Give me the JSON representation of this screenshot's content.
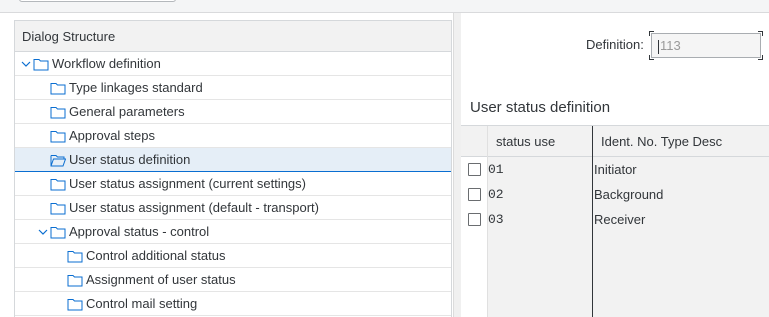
{
  "tree": {
    "header": "Dialog Structure",
    "items": [
      {
        "label": "Workflow definition",
        "level": 0,
        "expanded": true,
        "folder": "closed"
      },
      {
        "label": "Type linkages standard",
        "level": 1,
        "expanded": null,
        "folder": "closed"
      },
      {
        "label": "General parameters",
        "level": 1,
        "expanded": null,
        "folder": "closed"
      },
      {
        "label": "Approval steps",
        "level": 1,
        "expanded": null,
        "folder": "closed"
      },
      {
        "label": "User status definition",
        "level": 1,
        "expanded": null,
        "folder": "open",
        "selected": true
      },
      {
        "label": "User status assignment (current settings)",
        "level": 1,
        "expanded": null,
        "folder": "closed"
      },
      {
        "label": "User status assignment (default - transport)",
        "level": 1,
        "expanded": null,
        "folder": "closed"
      },
      {
        "label": "Approval status - control",
        "level": 1,
        "expanded": true,
        "folder": "closed"
      },
      {
        "label": "Control additional status",
        "level": 2,
        "expanded": null,
        "folder": "closed"
      },
      {
        "label": "Assignment of user status",
        "level": 2,
        "expanded": null,
        "folder": "closed"
      },
      {
        "label": "Control mail setting",
        "level": 2,
        "expanded": null,
        "folder": "closed"
      }
    ]
  },
  "definition": {
    "label": "Definition:",
    "value": "113"
  },
  "section_title": "User status definition",
  "table": {
    "columns": [
      "status use",
      "Ident. No. Type Desc"
    ],
    "rows": [
      {
        "status_use": "01",
        "desc": "Initiator",
        "checked": false
      },
      {
        "status_use": "02",
        "desc": "Background",
        "checked": false
      },
      {
        "status_use": "03",
        "desc": "Receiver",
        "checked": false
      }
    ],
    "empty_rows": 4
  },
  "colors": {
    "selection_bg": "#e5eef7",
    "selection_border": "#0a6ed1",
    "folder_stroke": "#0a6ed1",
    "text": "#32363a"
  },
  "icons": {
    "folder_closed": "folder-icon",
    "folder_open": "folder-open-icon",
    "expander": "chevron-down-icon"
  }
}
